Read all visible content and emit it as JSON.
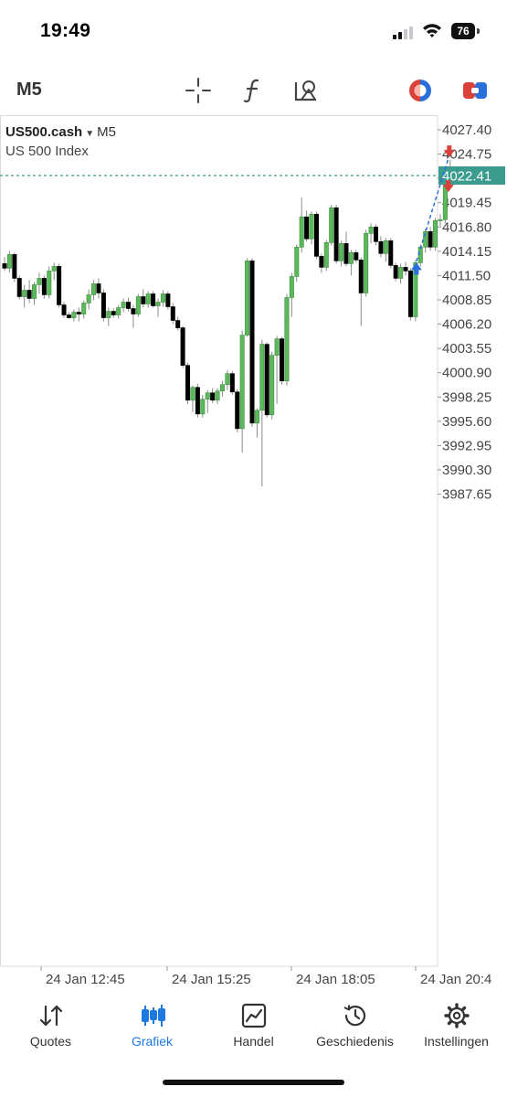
{
  "status": {
    "time": "19:49",
    "battery": "76"
  },
  "toolbar": {
    "timeframe": "M5"
  },
  "chart_header": {
    "symbol": "US500.cash",
    "timeframe": "M5",
    "description": "US 500 Index"
  },
  "chart_data": {
    "type": "candlestick",
    "symbol": "US500.cash",
    "timeframe": "M5",
    "y_ticks": [
      4027.4,
      4024.75,
      4022.1,
      4019.45,
      4016.8,
      4014.15,
      4011.5,
      4008.85,
      4006.2,
      4003.55,
      4000.9,
      3998.25,
      3995.6,
      3992.95,
      3990.3,
      3987.65
    ],
    "y_tick_labels": [
      "4027.40",
      "4024.75",
      "4022.10",
      "4019.45",
      "4016.80",
      "4014.15",
      "4011.50",
      "4008.85",
      "4006.20",
      "4003.55",
      "4000.90",
      "3998.25",
      "3995.60",
      "3992.95",
      "3990.30",
      "3987.65"
    ],
    "x_tick_labels": [
      "24 Jan 12:45",
      "24 Jan 15:25",
      "24 Jan 18:05",
      "24 Jan 20:4"
    ],
    "current_price": 4022.41,
    "current_price_label": "4022.41",
    "up_color": "#5cb85c",
    "down_color": "#000000",
    "price_line_color": "#3a9b8e",
    "trade_line_color": "#2a6fdb",
    "buy_arrow_color": "#2a6fdb",
    "sell_arrow_color": "#d9413a",
    "candles": [
      [
        4012.8,
        4013.5,
        4012.0,
        4012.3
      ],
      [
        4012.3,
        4014.2,
        4011.8,
        4013.8
      ],
      [
        4013.8,
        4014.0,
        4010.8,
        4011.2
      ],
      [
        4011.2,
        4011.5,
        4008.9,
        4009.2
      ],
      [
        4009.2,
        4010.5,
        4008.0,
        4009.9
      ],
      [
        4009.9,
        4011.0,
        4008.5,
        4009.0
      ],
      [
        4009.0,
        4010.8,
        4008.3,
        4010.5
      ],
      [
        4010.5,
        4011.8,
        4009.5,
        4011.2
      ],
      [
        4011.2,
        4011.5,
        4009.0,
        4009.4
      ],
      [
        4009.4,
        4012.5,
        4009.0,
        4012.0
      ],
      [
        4012.0,
        4012.9,
        4011.0,
        4012.5
      ],
      [
        4012.5,
        4012.8,
        4008.0,
        4008.3
      ],
      [
        4008.3,
        4008.6,
        4006.9,
        4007.2
      ],
      [
        4007.2,
        4007.5,
        4006.8,
        4006.9
      ],
      [
        4006.9,
        4007.8,
        4006.5,
        4007.5
      ],
      [
        4007.5,
        4008.0,
        4006.5,
        4007.3
      ],
      [
        4007.3,
        4008.8,
        4006.8,
        4008.5
      ],
      [
        4008.5,
        4010.0,
        4007.8,
        4009.4
      ],
      [
        4009.4,
        4011.0,
        4008.8,
        4010.6
      ],
      [
        4010.6,
        4011.2,
        4009.0,
        4009.6
      ],
      [
        4009.6,
        4010.0,
        4006.5,
        4006.9
      ],
      [
        4006.9,
        4008.0,
        4006.0,
        4007.6
      ],
      [
        4007.6,
        4007.9,
        4006.9,
        4007.2
      ],
      [
        4007.2,
        4008.3,
        4006.8,
        4008.0
      ],
      [
        4008.0,
        4009.0,
        4007.5,
        4008.6
      ],
      [
        4008.6,
        4009.1,
        4007.6,
        4007.9
      ],
      [
        4007.9,
        4008.3,
        4005.8,
        4007.3
      ],
      [
        4007.3,
        4009.5,
        4007.0,
        4009.2
      ],
      [
        4009.2,
        4010.0,
        4008.0,
        4008.4
      ],
      [
        4008.4,
        4009.8,
        4008.0,
        4009.5
      ],
      [
        4009.5,
        4009.8,
        4008.0,
        4008.2
      ],
      [
        4008.2,
        4009.0,
        4007.0,
        4008.6
      ],
      [
        4008.6,
        4009.9,
        4008.1,
        4009.5
      ],
      [
        4009.5,
        4009.8,
        4007.8,
        4008.1
      ],
      [
        4008.1,
        4008.5,
        4006.2,
        4006.6
      ],
      [
        4006.6,
        4007.0,
        4005.5,
        4005.8
      ],
      [
        4005.8,
        4006.0,
        4001.4,
        4001.7
      ],
      [
        4001.7,
        4002.0,
        3997.5,
        3997.9
      ],
      [
        3997.9,
        3999.5,
        3996.6,
        3999.3
      ],
      [
        3999.3,
        3999.7,
        3996.0,
        3996.4
      ],
      [
        3996.4,
        3998.5,
        3996.0,
        3998.0
      ],
      [
        3998.0,
        3999.0,
        3996.5,
        3998.7
      ],
      [
        3998.7,
        3999.2,
        3997.6,
        3997.9
      ],
      [
        3997.9,
        3999.2,
        3997.5,
        3998.9
      ],
      [
        3998.9,
        4000.0,
        3998.3,
        3999.6
      ],
      [
        3999.6,
        4001.2,
        3999.0,
        4000.8
      ],
      [
        4000.8,
        4001.1,
        3998.5,
        3998.8
      ],
      [
        3998.8,
        3999.1,
        3994.4,
        3994.8
      ],
      [
        3994.8,
        4005.5,
        3992.2,
        4005.0
      ],
      [
        4005.0,
        4013.4,
        4004.8,
        4013.1
      ],
      [
        4013.1,
        4013.4,
        3995.0,
        3995.4
      ],
      [
        3995.4,
        3997.0,
        3993.8,
        3996.8
      ],
      [
        3996.8,
        4004.5,
        3988.5,
        4004.0
      ],
      [
        4004.0,
        4004.2,
        3996.0,
        3996.3
      ],
      [
        3996.3,
        4003.2,
        3995.8,
        4002.8
      ],
      [
        4002.8,
        4004.9,
        3997.5,
        4004.6
      ],
      [
        4004.6,
        4004.8,
        3999.6,
        4000.0
      ],
      [
        4000.0,
        4009.5,
        3999.5,
        4009.1
      ],
      [
        4009.1,
        4011.8,
        4007.0,
        4011.4
      ],
      [
        4011.4,
        4014.9,
        4010.8,
        4014.6
      ],
      [
        4014.6,
        4020.0,
        4014.0,
        4017.9
      ],
      [
        4017.9,
        4018.6,
        4015.2,
        4015.5
      ],
      [
        4015.5,
        4018.5,
        4014.9,
        4018.2
      ],
      [
        4018.2,
        4018.5,
        4013.3,
        4013.6
      ],
      [
        4013.6,
        4013.9,
        4011.8,
        4012.4
      ],
      [
        4012.4,
        4015.4,
        4012.0,
        4015.1
      ],
      [
        4015.1,
        4019.2,
        4014.8,
        4018.9
      ],
      [
        4018.9,
        4019.2,
        4012.8,
        4013.1
      ],
      [
        4013.1,
        4015.3,
        4012.5,
        4015.0
      ],
      [
        4015.0,
        4016.3,
        4012.5,
        4012.8
      ],
      [
        4012.8,
        4014.3,
        4011.5,
        4014.0
      ],
      [
        4014.0,
        4014.3,
        4012.9,
        4013.2
      ],
      [
        4013.2,
        4013.5,
        4006.0,
        4009.6
      ],
      [
        4009.6,
        4016.5,
        4009.2,
        4016.1
      ],
      [
        4016.1,
        4017.2,
        4015.0,
        4016.8
      ],
      [
        4016.8,
        4017.1,
        4014.8,
        4015.2
      ],
      [
        4015.2,
        4015.8,
        4013.5,
        4013.9
      ],
      [
        4013.9,
        4015.6,
        4013.0,
        4015.3
      ],
      [
        4015.3,
        4015.6,
        4012.3,
        4012.6
      ],
      [
        4012.6,
        4012.9,
        4010.9,
        4011.2
      ],
      [
        4011.2,
        4012.8,
        4010.6,
        4012.4
      ],
      [
        4012.4,
        4013.0,
        4011.5,
        4012.0
      ],
      [
        4012.0,
        4012.3,
        4006.6,
        4007.0
      ],
      [
        4007.0,
        4013.2,
        4006.5,
        4012.9
      ],
      [
        4012.9,
        4014.9,
        4012.5,
        4014.6
      ],
      [
        4014.6,
        4016.6,
        4014.0,
        4016.3
      ],
      [
        4016.3,
        4016.8,
        4014.2,
        4014.6
      ],
      [
        4014.6,
        4017.8,
        4014.2,
        4017.5
      ],
      [
        4017.5,
        4018.2,
        4016.9,
        4017.6
      ],
      [
        4017.6,
        4023.2,
        4017.2,
        4022.2
      ],
      [
        4022.2,
        4024.1,
        4022.0,
        4022.41
      ]
    ],
    "trade_markers": [
      {
        "type": "buy",
        "index": 83,
        "price": 4012.4
      },
      {
        "type": "sell",
        "index": 90,
        "price": 4024.6
      },
      {
        "type": "sell",
        "index": 90,
        "price": 4022.0
      }
    ]
  },
  "nav": {
    "items": [
      {
        "label": "Quotes",
        "icon": "quotes-arrows-icon"
      },
      {
        "label": "Grafiek",
        "icon": "chart-candles-icon"
      },
      {
        "label": "Handel",
        "icon": "trade-chart-icon"
      },
      {
        "label": "Geschiedenis",
        "icon": "history-clock-icon"
      },
      {
        "label": "Instellingen",
        "icon": "settings-gear-icon"
      }
    ],
    "active_index": 1
  },
  "colors": {
    "accent": "#1f7ae0",
    "text": "#333333"
  }
}
